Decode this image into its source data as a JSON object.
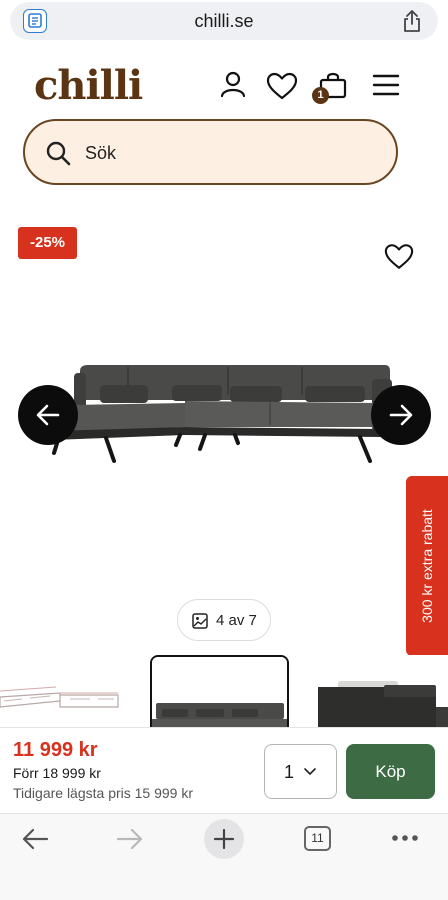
{
  "browser": {
    "url": "chilli.se",
    "tab_count": "11"
  },
  "header": {
    "logo": "chilli",
    "cart_count": "1"
  },
  "search": {
    "placeholder": "Sök"
  },
  "product": {
    "discount_badge": "-25%",
    "image_counter": "4 av 7",
    "side_tab": "300 kr extra rabatt"
  },
  "purchase": {
    "price": "11 999 kr",
    "was_price": "Förr 18 999 kr",
    "lowest_price": "Tidigare lägsta pris 15 999 kr",
    "quantity": "1",
    "buy_label": "Köp"
  },
  "colors": {
    "brand": "#5a3413",
    "sale_red": "#d6321e",
    "buy_green": "#3d6b44",
    "search_bg": "#fdefe2"
  },
  "icons": [
    "page-icon",
    "share-icon",
    "account-icon",
    "heart-icon",
    "cart-icon",
    "menu-icon",
    "search-icon",
    "wishlist-icon",
    "arrow-left-icon",
    "arrow-right-icon",
    "gallery-icon",
    "chevron-down-icon",
    "back-icon",
    "forward-icon",
    "new-tab-icon",
    "more-icon"
  ]
}
